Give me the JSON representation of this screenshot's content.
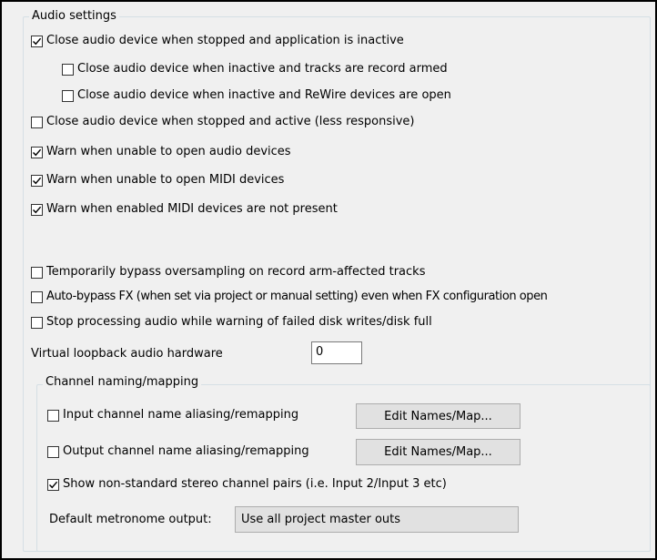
{
  "audio_settings": {
    "title": "Audio settings",
    "options": [
      {
        "label": "Close audio device when stopped and application is inactive",
        "checked": true
      },
      {
        "label": "Close audio device when inactive and tracks are record armed",
        "checked": false
      },
      {
        "label": "Close audio device when inactive and ReWire devices are open",
        "checked": false
      },
      {
        "label": "Close audio device when stopped and active (less responsive)",
        "checked": false
      },
      {
        "label": "Warn when unable to open audio devices",
        "checked": true
      },
      {
        "label": "Warn when unable to open MIDI devices",
        "checked": true
      },
      {
        "label": "Warn when enabled MIDI devices are not present",
        "checked": true
      },
      {
        "label": "Temporarily bypass oversampling on record arm-affected tracks",
        "checked": false
      },
      {
        "label": "Auto-bypass FX (when set via project or manual setting) even when FX configuration open",
        "checked": false
      },
      {
        "label": "Stop processing audio while warning of failed disk writes/disk full",
        "checked": false
      }
    ],
    "loopback_label": "Virtual loopback audio hardware",
    "loopback_value": "0"
  },
  "channel_naming": {
    "title": "Channel naming/mapping",
    "input_alias": {
      "label": "Input channel name aliasing/remapping",
      "checked": false,
      "button": "Edit Names/Map..."
    },
    "output_alias": {
      "label": "Output channel name aliasing/remapping",
      "checked": false,
      "button": "Edit Names/Map..."
    },
    "stereo_pairs": {
      "label": "Show non-standard stereo channel pairs (i.e. Input 2/Input 3 etc)",
      "checked": true
    },
    "metronome_label": "Default metronome output:",
    "metronome_value": "Use all project master outs"
  }
}
